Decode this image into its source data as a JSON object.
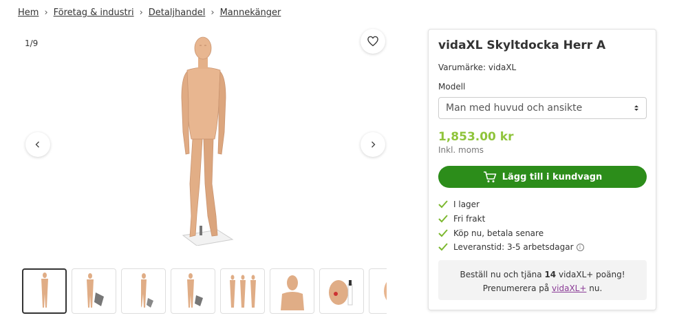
{
  "breadcrumb": {
    "items": [
      "Hem",
      "Företag & industri",
      "Detaljhandel",
      "Mannekänger"
    ],
    "separator": "›"
  },
  "gallery": {
    "counter": "1/9",
    "favorite_icon": "heart-icon",
    "prev_icon": "chevron-left-icon",
    "next_icon": "chevron-right-icon",
    "thumbnail_count": 8
  },
  "product": {
    "title": "vidaXL Skyltdocka Herr A",
    "brand_text": "Varumärke: vidaXL",
    "model_label": "Modell",
    "model_selected": "Man med huvud och ansikte",
    "price": "1,853.00 kr",
    "tax_note": "Inkl. moms",
    "cart_button": "Lägg till i kundvagn",
    "features": [
      "I lager",
      "Fri frakt",
      "Köp nu, betala senare",
      "Leveranstid: 3-5 arbetsdagar"
    ],
    "promo": {
      "prefix": "Beställ nu och tjäna ",
      "points": "14",
      "suffix": " vidaXL+ poäng!",
      "line2_prefix": "Prenumerera på ",
      "link": "vidaXL+",
      "line2_suffix": " nu."
    }
  },
  "colors": {
    "price": "#8fc43b",
    "cart_button": "#2c8d1a",
    "check": "#7cb82f",
    "link": "#8a3b96",
    "skin": "#e6b58f"
  }
}
